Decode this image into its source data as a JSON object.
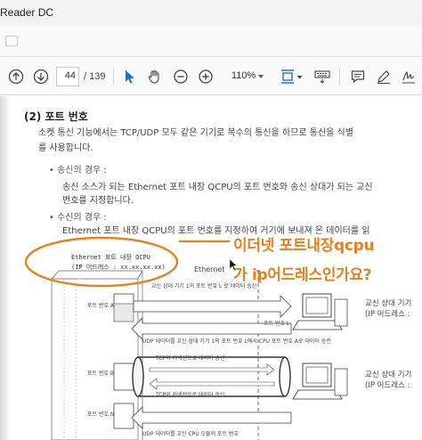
{
  "window": {
    "title": "Reader DC"
  },
  "toolbar": {
    "page_current": "44",
    "page_total": "/ 139",
    "zoom": "110%",
    "icons": [
      "page-up-icon",
      "page-down-icon",
      "select-arrow-icon",
      "hand-icon",
      "zoom-out-icon",
      "zoom-in-icon",
      "fit-page-icon",
      "keyboard-icon",
      "comment-icon",
      "pen-icon",
      "sign-icon"
    ]
  },
  "document": {
    "heading": "(2) 포트 번호",
    "para1": "소켓 통신 기능에서는 TCP/UDP 모두 같은 기기로 복수의 통신을 하므로 통신을 식별",
    "para2": "를 사용합니다.",
    "bullet1": "• 송신의 경우 :",
    "para3": "송신 소스가 되는 Ethernet 포트 내장 QCPU의 포트 번호와 송신 상대가 되는 교신",
    "para4": "번호를 지정합니다.",
    "bullet2": "• 수신의 경우 :",
    "para5": "Ethernet 포트 내장 QCPU의 포트 번호를 지정하여 거기에 보내져 온 데이터를 읽"
  },
  "diagram": {
    "cpu_label_line1": "Ethernet 포트 내장 QCPU",
    "cpu_label_line2": "(IP 어드레스 : xx.xx.xx.xx)",
    "network_label": "Ethernet",
    "port_label_1": "포트 번호 A",
    "port_label_l": "포트 번호 L",
    "port_label_2": "포트 번호 B",
    "port_label_n": "포트 번호 N",
    "flow1": "교신 상대 기기 1의 포트 번호 L 로 데이터 송신",
    "flow2": "UDP 데이터를 교신 상대 기기 1의 포트 번호 L에서 CPU 포트 번호 A로 데이터 송신",
    "flow3": "TCP의 커넥션으로 데이터 송신",
    "flow4": "TCP의 커넥션으로 데이터 송신",
    "flow5": "UDP 데이터를 교신 CPU 모듈의 포트 번호",
    "remote1_line1": "교신 상대 기기",
    "remote1_line2": "(IP 어드레스 :",
    "remote2_line1": "교신 상대 기기",
    "remote2_line2": "(IP 어드레스 :"
  },
  "overlay": {
    "line1": "이더넷 포트내장qcpu",
    "line2": "가 ip어드레스인가요?",
    "color": "#e8801e"
  }
}
